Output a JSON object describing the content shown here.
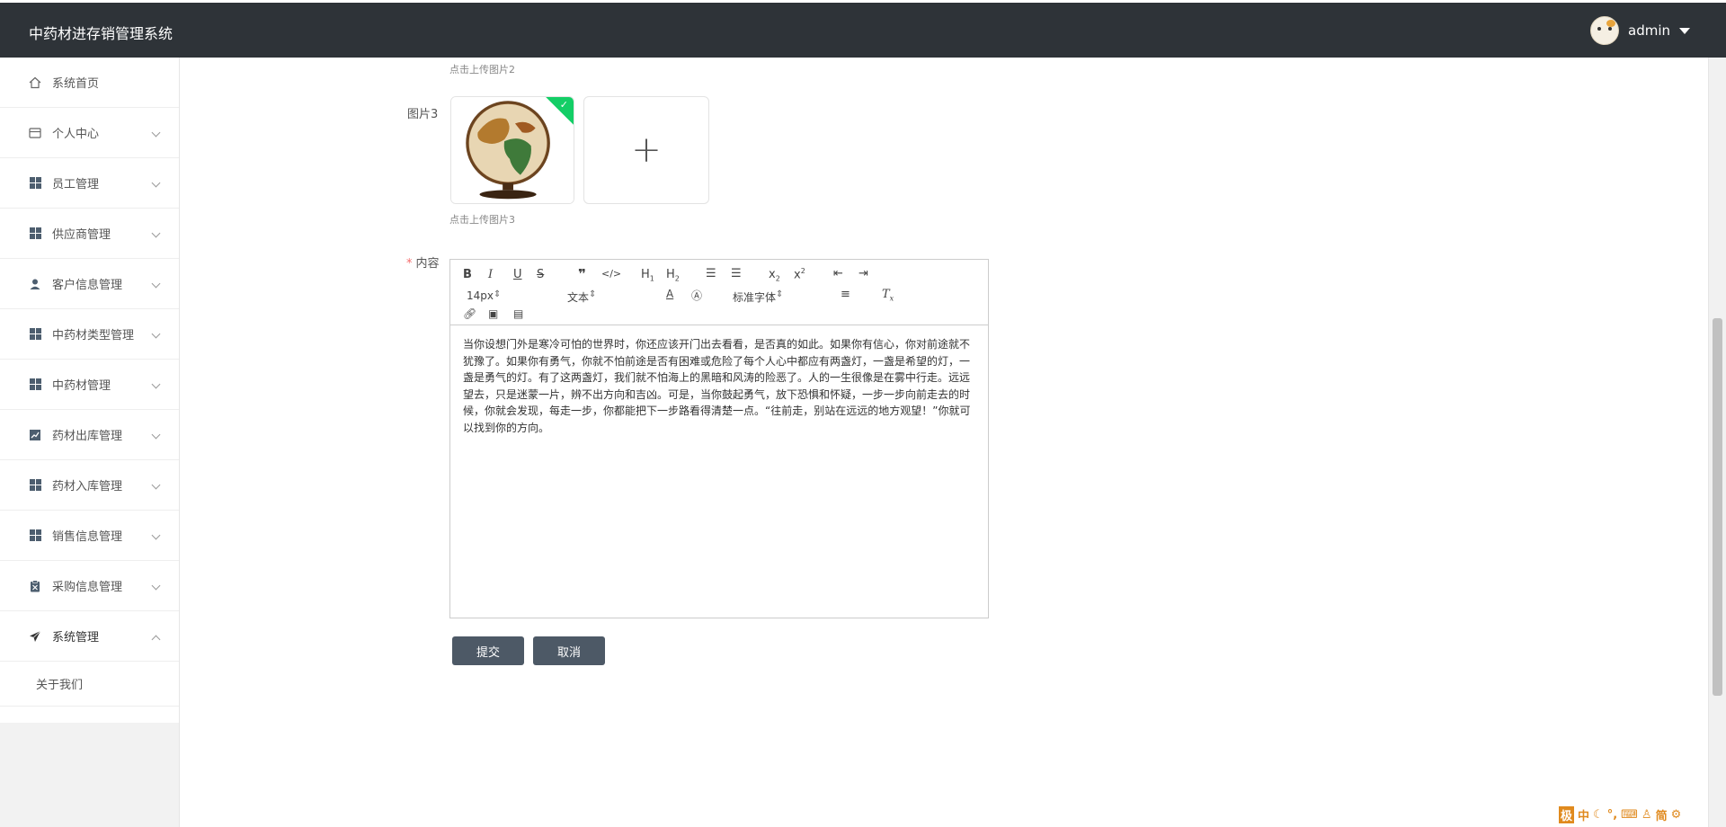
{
  "header": {
    "title": "中药材进存销管理系统",
    "username": "admin"
  },
  "sidebar": {
    "items": [
      {
        "label": "系统首页",
        "icon": "home-icon"
      },
      {
        "label": "个人中心",
        "icon": "card-icon"
      },
      {
        "label": "员工管理",
        "icon": "grid-icon"
      },
      {
        "label": "供应商管理",
        "icon": "grid-icon"
      },
      {
        "label": "客户信息管理",
        "icon": "user-icon"
      },
      {
        "label": "中药材类型管理",
        "icon": "grid-icon"
      },
      {
        "label": "中药材管理",
        "icon": "grid-icon"
      },
      {
        "label": "药材出库管理",
        "icon": "chart-icon"
      },
      {
        "label": "药材入库管理",
        "icon": "grid-icon"
      },
      {
        "label": "销售信息管理",
        "icon": "grid-icon"
      },
      {
        "label": "采购信息管理",
        "icon": "clipboard-icon"
      },
      {
        "label": "系统管理",
        "icon": "send-icon"
      }
    ],
    "submenu": [
      {
        "label": "关于我们"
      }
    ]
  },
  "form": {
    "hint_image2": "点击上传图片2",
    "label_image3": "图片3",
    "hint_image3": "点击上传图片3",
    "label_content": "内容",
    "required_mark": "*",
    "editor": {
      "font_size": "14px",
      "header_picker": "文本",
      "font_family": "标准字体",
      "content": "当你设想门外是寒冷可怕的世界时，你还应该开门出去看看，是否真的如此。如果你有信心，你对前途就不犹豫了。如果你有勇气，你就不怕前途是否有困难或危险了每个人心中都应有两盏灯，一盏是希望的灯，一盏是勇气的灯。有了这两盏灯，我们就不怕海上的黑暗和风涛的险恶了。人的一生很像是在雾中行走。远远望去，只是迷蒙一片，辨不出方向和吉凶。可是，当你鼓起勇气，放下恐惧和怀疑，一步一步向前走去的时候，你就会发现，每走一步，你都能把下一步路看得清楚一点。“往前走，别站在远远的地方观望！”你就可以找到你的方向。"
    },
    "submit_label": "提交",
    "cancel_label": "取消"
  },
  "ime": {
    "items": [
      "极",
      "中",
      "简"
    ]
  },
  "colors": {
    "header_bg": "#2e3338",
    "button_bg": "#4d5966",
    "success": "#13ce66",
    "required": "#f56c6c"
  }
}
